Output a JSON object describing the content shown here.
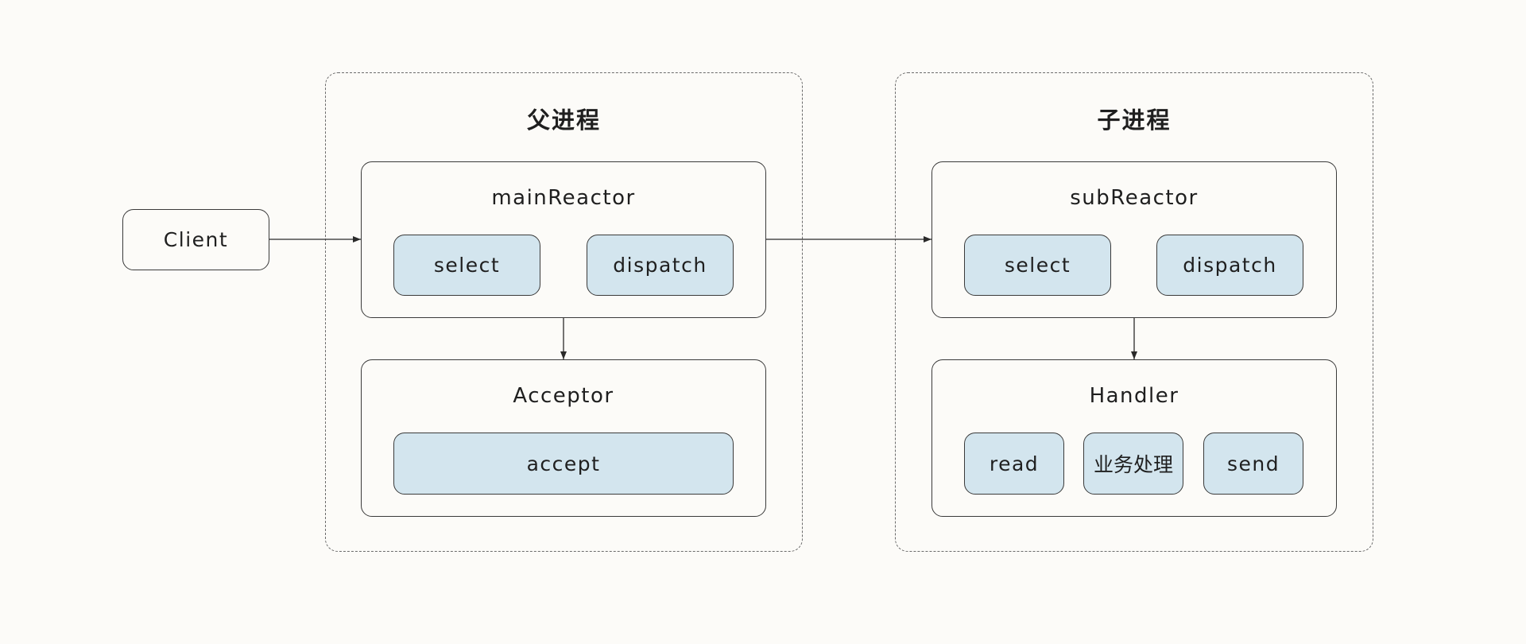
{
  "client": {
    "label": "Client"
  },
  "parent_process": {
    "title": "父进程",
    "main_reactor": {
      "title": "mainReactor",
      "items": [
        "select",
        "dispatch"
      ]
    },
    "acceptor": {
      "title": "Acceptor",
      "items": [
        "accept"
      ]
    }
  },
  "child_process": {
    "title": "子进程",
    "sub_reactor": {
      "title": "subReactor",
      "items": [
        "select",
        "dispatch"
      ]
    },
    "handler": {
      "title": "Handler",
      "items": [
        "read",
        "业务处理",
        "send"
      ]
    }
  },
  "colors": {
    "background": "#fcfbf8",
    "component_fill": "#d3e5ee",
    "border": "#3a3a3a",
    "dashed_border": "#6b6b6b"
  }
}
